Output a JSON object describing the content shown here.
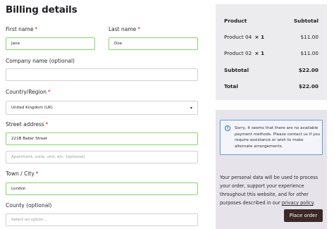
{
  "billing": {
    "title": "Billing details",
    "first_name": {
      "label": "First name",
      "value": "Jane"
    },
    "last_name": {
      "label": "Last name",
      "value": "Doe"
    },
    "company": {
      "label": "Company name (optional)",
      "value": ""
    },
    "country": {
      "label": "Country/Region",
      "value": "United Kingdom (UK)"
    },
    "street": {
      "label": "Street address",
      "value": "221B Baker Street",
      "placeholder2": "Apartment, suite, unit, etc. (optional)"
    },
    "town": {
      "label": "Town / City",
      "value": "London"
    },
    "county": {
      "label": "County (optional)",
      "placeholder": "Select an option…"
    },
    "required_marker": "*"
  },
  "order_summary": {
    "header_product": "Product",
    "header_subtotal": "Subtotal",
    "items": [
      {
        "name": "Product 04",
        "qty": "× 1",
        "price": "$11.00"
      },
      {
        "name": "Product 02",
        "qty": "× 1",
        "price": "$11.00"
      }
    ],
    "subtotal_label": "Subtotal",
    "subtotal_value": "$22.00",
    "total_label": "Total",
    "total_value": "$22.00"
  },
  "payment": {
    "notice_icon": "i",
    "notice": "Sorry, it seems that there are no available payment methods. Please contact us if you require assistance or wish to make alternate arrangements.",
    "privacy_text": "Your personal data will be used to process your order, support your experience throughout this website, and for other purposes described in our ",
    "privacy_link": "privacy policy",
    "privacy_end": ".",
    "place_order": "Place order"
  },
  "colors": {
    "valid_border": "#8bd36b",
    "required": "#d6271c",
    "button_bg": "#3c2827",
    "summary_bg": "#ececee",
    "payment_bg": "#e6e4ea",
    "notice_border": "#5f9fe0"
  }
}
